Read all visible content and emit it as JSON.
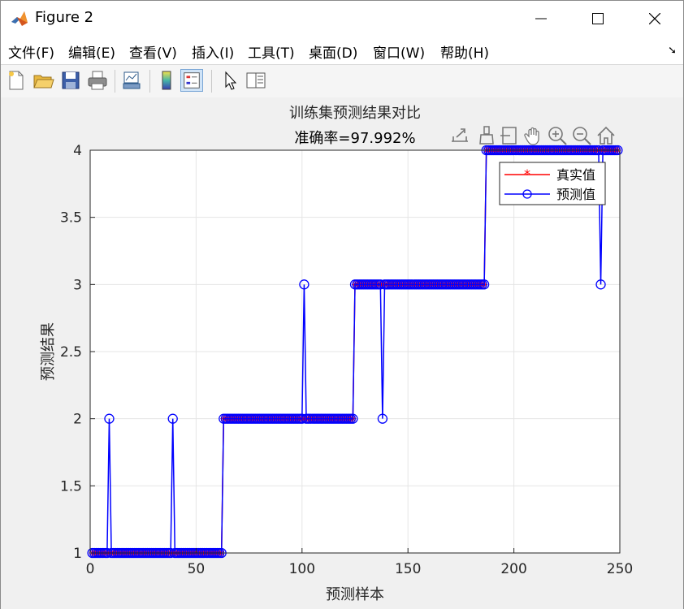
{
  "window": {
    "title": "Figure 2",
    "controls": {
      "minimize": "—",
      "maximize": "☐",
      "close": "✕"
    }
  },
  "menu": [
    "文件(F)",
    "编辑(E)",
    "查看(V)",
    "插入(I)",
    "工具(T)",
    "桌面(D)",
    "窗口(W)",
    "帮助(H)"
  ],
  "toolbar": {
    "buttons": [
      "new-figure-icon",
      "open-file-icon",
      "save-icon",
      "print-icon",
      "link-plot-icon",
      "colorbar-icon",
      "legend-icon",
      "pointer-icon",
      "property-editor-icon"
    ],
    "active": "legend-icon"
  },
  "axes_toolbar": [
    "export-icon",
    "brush-icon",
    "data-tips-icon",
    "pan-icon",
    "zoom-in-icon",
    "zoom-out-icon",
    "home-icon"
  ],
  "colors": {
    "real": "#ff0000",
    "pred": "#0000ff",
    "grid": "#e5e5e5",
    "axis": "#262626"
  },
  "chart_data": {
    "type": "line",
    "title": "训练集预测结果对比",
    "subtitle": "准确率=97.992%",
    "xlabel": "预测样本",
    "ylabel": "预测结果",
    "xlim": [
      0,
      250
    ],
    "ylim": [
      1,
      4
    ],
    "xticks": [
      0,
      50,
      100,
      150,
      200,
      250
    ],
    "yticks": [
      1,
      1.5,
      2,
      2.5,
      3,
      3.5,
      4
    ],
    "xtick_labels": [
      "0",
      "50",
      "100",
      "150",
      "200",
      "250"
    ],
    "ytick_labels": [
      "1",
      "1.5",
      "2",
      "2.5",
      "3",
      "3.5",
      "4"
    ],
    "grid": true,
    "legend_position": "top-right",
    "n_samples": 249,
    "series": [
      {
        "name": "真实值",
        "marker": "*",
        "color": "#ff0000",
        "segments": [
          {
            "from": 1,
            "to": 62,
            "value": 1
          },
          {
            "from": 63,
            "to": 124,
            "value": 2
          },
          {
            "from": 125,
            "to": 186,
            "value": 3
          },
          {
            "from": 187,
            "to": 249,
            "value": 4
          }
        ]
      },
      {
        "name": "预测值",
        "marker": "o",
        "color": "#0000ff",
        "segments": [
          {
            "from": 1,
            "to": 62,
            "value": 1
          },
          {
            "from": 63,
            "to": 124,
            "value": 2
          },
          {
            "from": 125,
            "to": 186,
            "value": 3
          },
          {
            "from": 187,
            "to": 249,
            "value": 4
          }
        ],
        "deviations": [
          {
            "x": 9,
            "value": 2
          },
          {
            "x": 39,
            "value": 2
          },
          {
            "x": 101,
            "value": 3
          },
          {
            "x": 138,
            "value": 2
          },
          {
            "x": 241,
            "value": 3
          }
        ]
      }
    ]
  }
}
